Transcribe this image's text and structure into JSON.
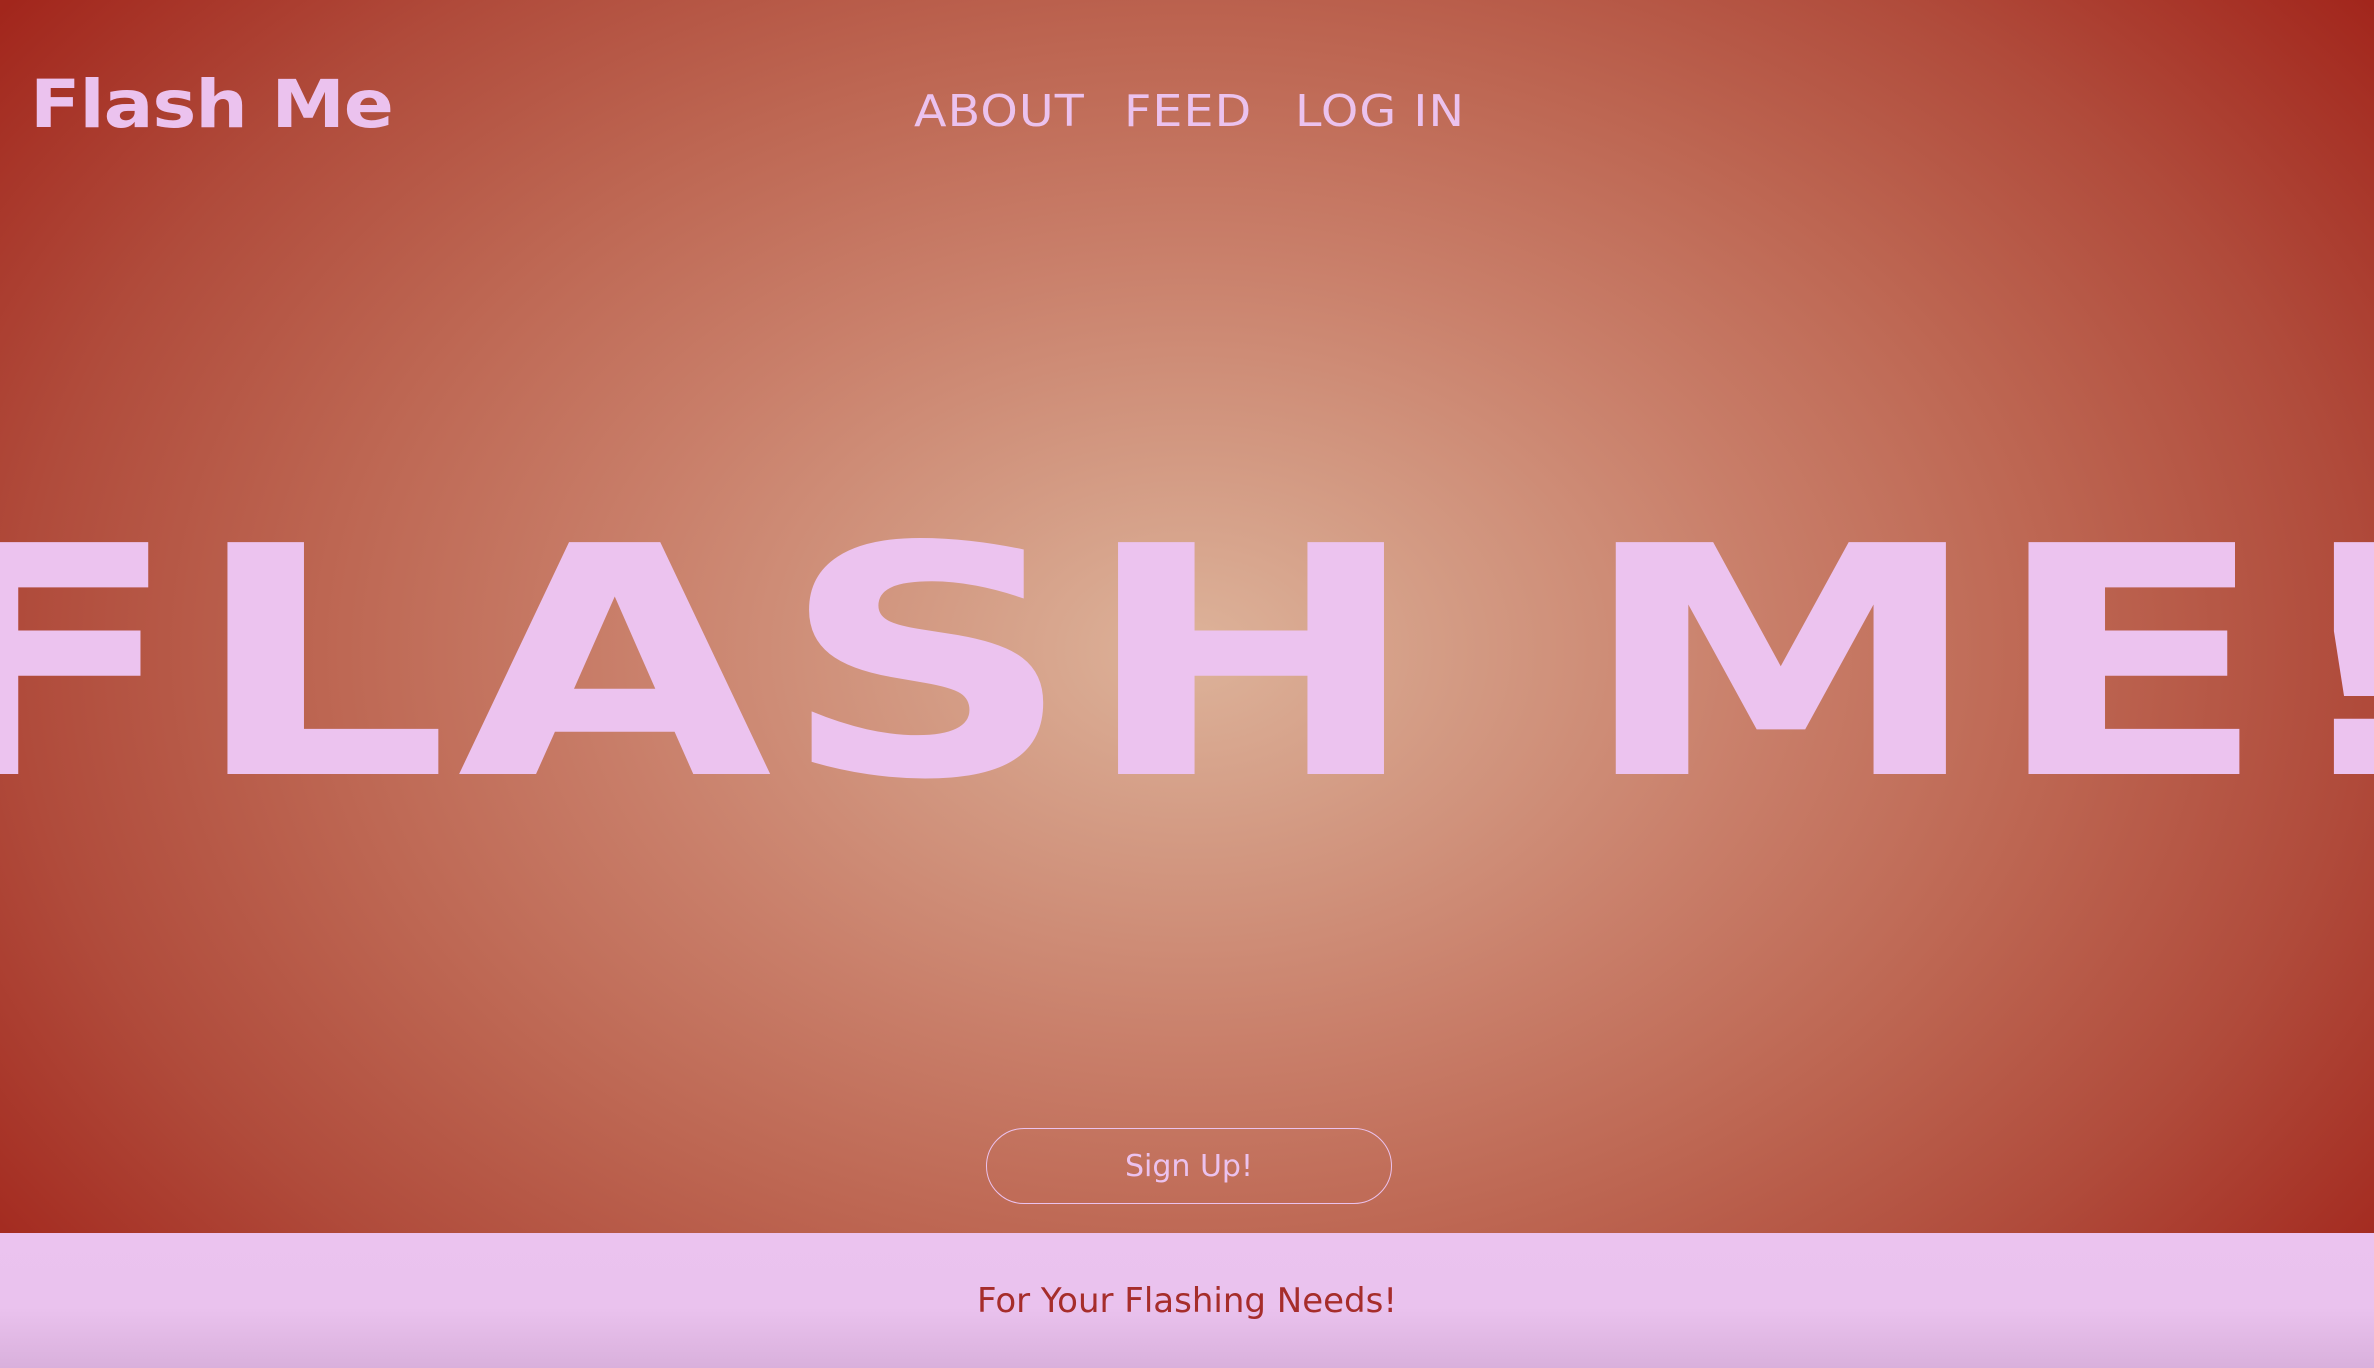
{
  "header": {
    "logo": "Flash Me",
    "nav": [
      {
        "label": "ABOUT"
      },
      {
        "label": "FEED"
      },
      {
        "label": "LOG IN"
      }
    ]
  },
  "hero": {
    "headline": "FLASH ME!",
    "cta_label": "Sign Up!"
  },
  "footer": {
    "tagline": "For Your Flashing Needs!"
  },
  "colors": {
    "hero_center": "#ddb39a",
    "hero_edge": "#a2261c",
    "text_pink": "#ebc2ee",
    "footer_bg": "#ebc3ef",
    "tagline_red": "#a62d2b"
  }
}
